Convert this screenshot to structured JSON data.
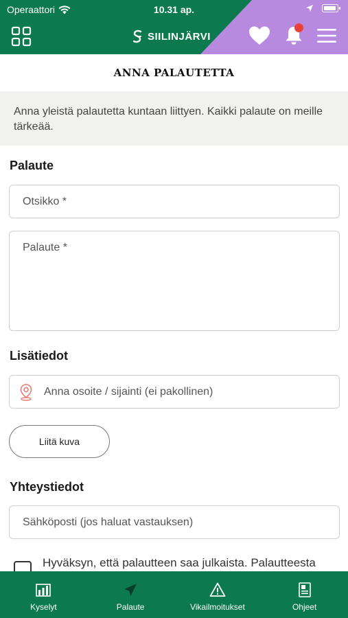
{
  "status_bar": {
    "carrier": "Operaattori",
    "time": "10.31 ap."
  },
  "header": {
    "brand": "SIILINJÄRVI",
    "grid_icon": "grid-icon",
    "heart_icon": "heart-icon",
    "bell_icon": "bell-icon",
    "menu_icon": "menu-icon",
    "notification": true
  },
  "page": {
    "title": "ANNA PALAUTETTA",
    "intro": "Anna yleistä palautetta kuntaan liittyen. Kaikki palaute on meille tärkeää."
  },
  "form": {
    "feedback_section": "Palaute",
    "subject_placeholder": "Otsikko *",
    "feedback_placeholder": "Palaute *",
    "details_section": "Lisätiedot",
    "location_placeholder": "Anna osoite / sijainti (ei pakollinen)",
    "location_icon": "location-pin-icon",
    "attach_label": "Liitä kuva",
    "contact_section": "Yhteystiedot",
    "email_placeholder": "Sähköposti (jos haluat vastauksen)",
    "consent_text": "Hyväksyn, että palautteen saa julkaista. Palautteesta"
  },
  "nav": {
    "items": [
      {
        "label": "Kyselyt",
        "icon": "bar-chart-icon"
      },
      {
        "label": "Palaute",
        "icon": "paper-plane-icon"
      },
      {
        "label": "Vikailmoitukset",
        "icon": "warning-icon"
      },
      {
        "label": "Ohjeet",
        "icon": "document-icon"
      }
    ]
  },
  "colors": {
    "primary": "#0c7a4e",
    "accent": "#b78ae0",
    "notification": "#e8413a"
  }
}
